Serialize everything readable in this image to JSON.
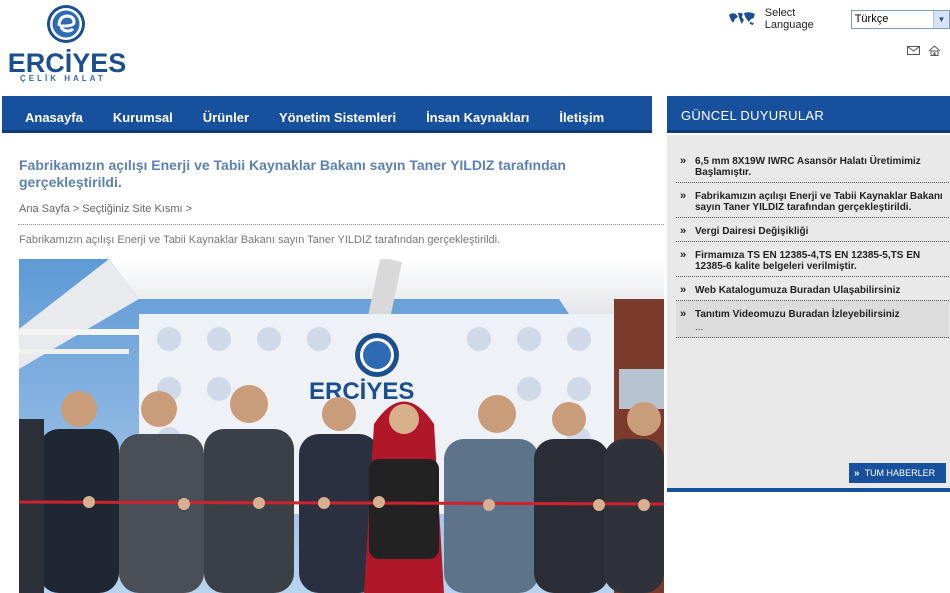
{
  "logo": {
    "name": "ERCİYES",
    "subtitle": "ÇELİK HALAT"
  },
  "header": {
    "language_label": "Select Language",
    "language_value": "Türkçe",
    "icons": [
      "globe-icon",
      "mail-icon",
      "home-icon"
    ]
  },
  "nav": {
    "items": [
      {
        "label": "Anasayfa"
      },
      {
        "label": "Kurumsal"
      },
      {
        "label": "Ürünler"
      },
      {
        "label": "Yönetim Sistemleri"
      },
      {
        "label": "İnsan Kaynakları"
      },
      {
        "label": "İletişim"
      }
    ]
  },
  "main": {
    "title": "Fabrikamızın açılışı Enerji ve Tabii Kaynaklar Bakanı sayın Taner YILDIZ tarafından gerçekleştirildi.",
    "breadcrumb": "Ana Sayfa > Seçtiğiniz Site Kısmı >",
    "intro": "Fabrikamızın açılışı Enerji ve Tabii Kaynaklar Bakanı sayın Taner YILDIZ tarafından gerçekleştirildi.",
    "photo_banner": "ERCİYES"
  },
  "sidebar": {
    "title": "GÜNCEL DUYURULAR",
    "news": [
      {
        "text": "6,5 mm 8X19W IWRC Asansör Halatı Üretimimiz Başlamıştır."
      },
      {
        "text": "Fabrikamızın açılışı Enerji ve Tabii Kaynaklar Bakanı sayın Taner YILDIZ tarafından gerçekleştirildi."
      },
      {
        "text": "Vergi Dairesi Değişikliği"
      },
      {
        "text": "Firmamıza TS EN 12385-4,TS EN 12385-5,TS EN 12385-6 kalite belgeleri verilmiştir."
      },
      {
        "text": "Web Katalogumuza Buradan Ulaşabilirsiniz"
      },
      {
        "text": "Tanıtım Videomuzu Buradan İzleyebilirsiniz",
        "more": "..."
      }
    ],
    "all_news_label": "TUM HABERLER"
  },
  "colors": {
    "brand_blue": "#17509c",
    "title_blue": "#5c82b2",
    "panel_gray": "#e9e9e9"
  }
}
